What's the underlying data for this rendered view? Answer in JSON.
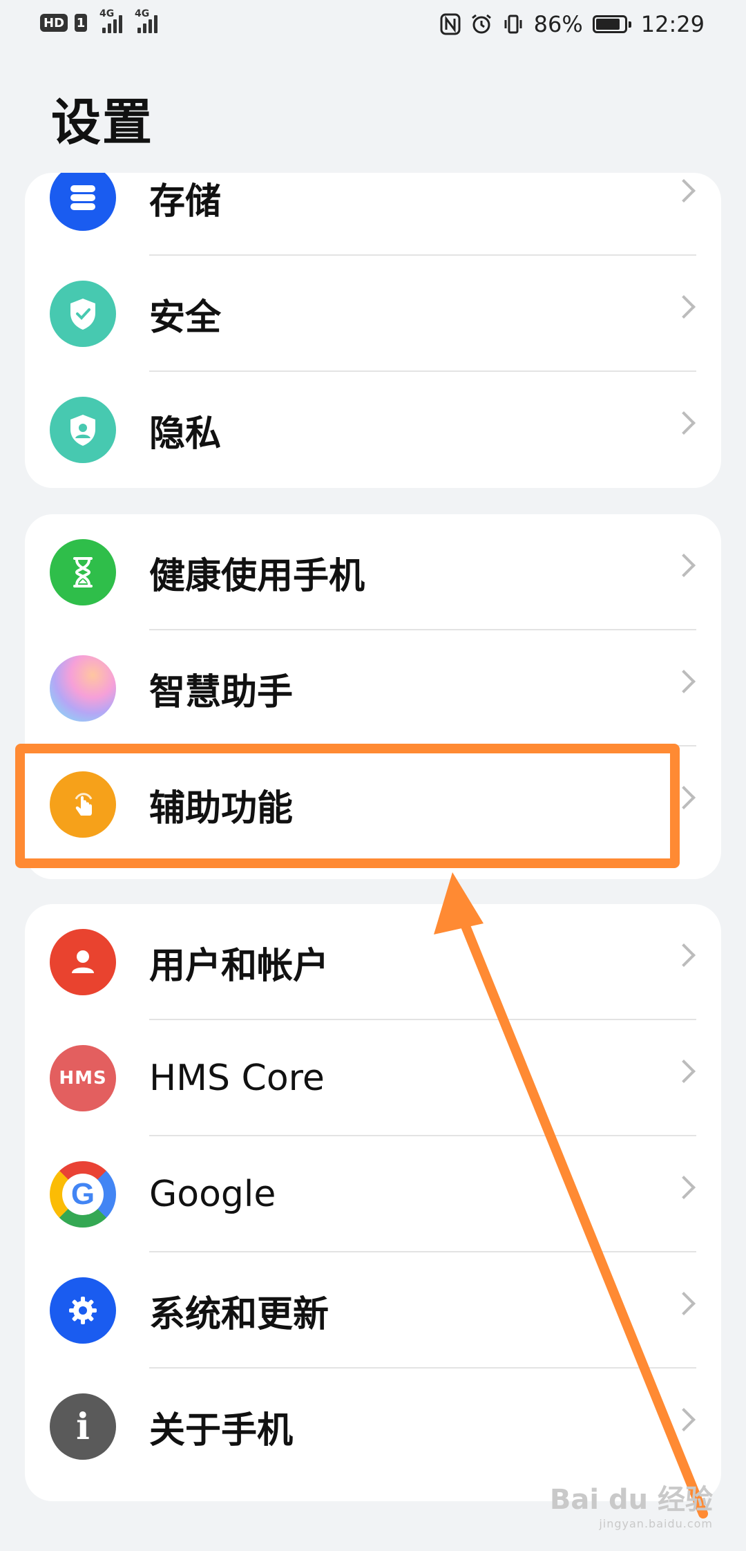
{
  "status_bar": {
    "hd_label": "HD",
    "sim_label": "1",
    "network_1": "4G",
    "network_2": "4G",
    "battery_percent": "86%",
    "battery_level": 0.86,
    "time": "12:29",
    "icons": [
      "nfc-icon",
      "alarm-icon",
      "vibrate-icon",
      "battery-icon"
    ]
  },
  "header": {
    "title": "设置"
  },
  "groups": [
    {
      "items": [
        {
          "label": "存储",
          "icon": "storage-icon",
          "color": "#1a5cf0"
        },
        {
          "label": "安全",
          "icon": "shield-check-icon",
          "color": "#47c9b0"
        },
        {
          "label": "隐私",
          "icon": "privacy-shield-icon",
          "color": "#47c9b0"
        }
      ]
    },
    {
      "items": [
        {
          "label": "健康使用手机",
          "icon": "hourglass-icon",
          "color": "#2fbe4a"
        },
        {
          "label": "智慧助手",
          "icon": "assistant-orb-icon",
          "color": "#e9a7e7"
        },
        {
          "label": "辅助功能",
          "icon": "accessibility-hand-icon",
          "color": "#f6a11a"
        }
      ]
    },
    {
      "items": [
        {
          "label": "用户和帐户",
          "icon": "user-icon",
          "color": "#e9432f"
        },
        {
          "label": "HMS Core",
          "icon": "hms-icon",
          "color": "#e35f5f",
          "icon_text": "HMS"
        },
        {
          "label": "Google",
          "icon": "google-icon",
          "color": "#ffffff",
          "icon_text": "G"
        },
        {
          "label": "系统和更新",
          "icon": "gear-icon",
          "color": "#1a5cf0"
        },
        {
          "label": "关于手机",
          "icon": "info-icon",
          "color": "#5a5a5a",
          "icon_text": "i"
        }
      ]
    }
  ],
  "annotation": {
    "highlight_color": "#ff8a33"
  },
  "watermark": {
    "main": "Bai du 经验",
    "sub": "jingyan.baidu.com"
  }
}
